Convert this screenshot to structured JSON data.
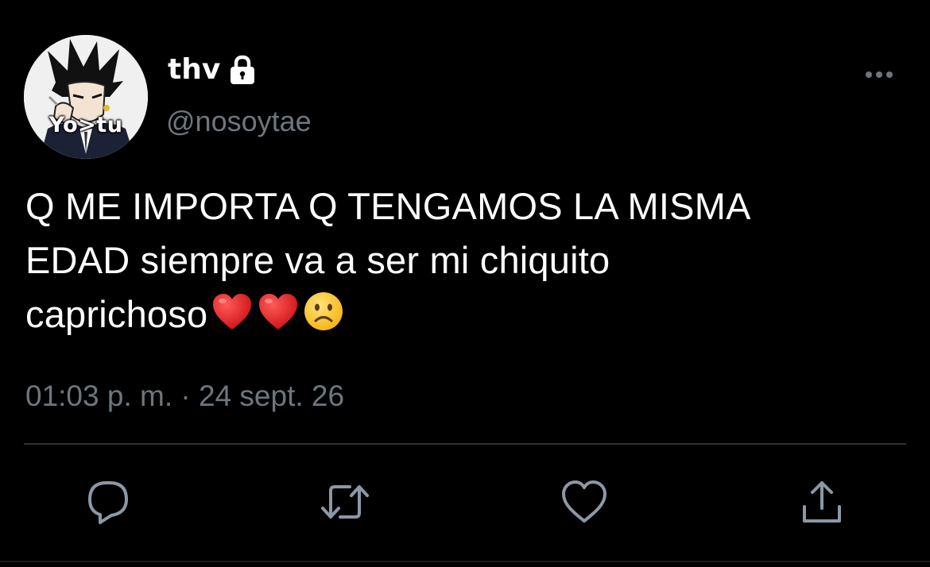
{
  "author": {
    "display_name": "thv",
    "username": "@nosoytae",
    "avatar_caption": "Yo>tu",
    "protected_icon": "lock-icon"
  },
  "tweet": {
    "text": "Q ME IMPORTA Q TENGAMOS LA MISMA\nEDAD siempre va a ser mi chiquito\ncaprichoso",
    "emojis": [
      "red-heart",
      "red-heart",
      "frowning-face"
    ],
    "timestamp": "01:03 p. m. · 24 sept. 26"
  },
  "actions": [
    {
      "name": "reply",
      "icon": "reply-icon"
    },
    {
      "name": "retweet",
      "icon": "retweet-icon"
    },
    {
      "name": "like",
      "icon": "heart-icon"
    },
    {
      "name": "share",
      "icon": "share-icon"
    }
  ],
  "colors": {
    "background": "#000000",
    "text_primary": "#ffffff",
    "text_secondary": "#6e767d",
    "divider": "#2f3336",
    "action_icon": "#8b98a5"
  }
}
